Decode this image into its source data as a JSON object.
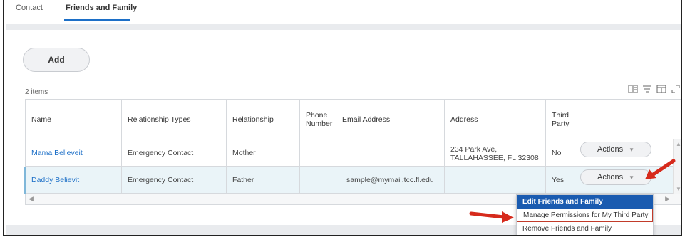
{
  "tabs": [
    {
      "label": "Contact"
    },
    {
      "label": "Friends and Family"
    }
  ],
  "add_button": "Add",
  "item_count": "2 items",
  "toolbar_icons": [
    "column-chooser-icon",
    "filter-icon",
    "table-view-icon",
    "expand-icon"
  ],
  "table": {
    "headers": [
      "Name",
      "Relationship Types",
      "Relationship",
      "Phone Number",
      "Email Address",
      "Address",
      "Third Party",
      ""
    ],
    "rows": [
      {
        "name": "Mama Believeit",
        "relationship_types": "Emergency Contact",
        "relationship": "Mother",
        "phone": "",
        "email": "",
        "address": "234 Park Ave, TALLAHASSEE, FL 32308",
        "third_party": "No",
        "actions": "Actions"
      },
      {
        "name": "Daddy Believit",
        "relationship_types": "Emergency Contact",
        "relationship": "Father",
        "phone": "",
        "email": "sample@mymail.tcc.fl.edu",
        "address": "",
        "third_party": "Yes",
        "actions": "Actions"
      }
    ]
  },
  "actions_menu": {
    "items": [
      "Edit Friends and Family",
      "Manage Permissions for My Third Party",
      "Remove Friends and Family"
    ],
    "selected_index": 0,
    "highlighted_index": 1
  },
  "colors": {
    "accent": "#1c6fc7",
    "menu_selected": "#1a5bb0",
    "annotation_arrow": "#d62a1c"
  }
}
